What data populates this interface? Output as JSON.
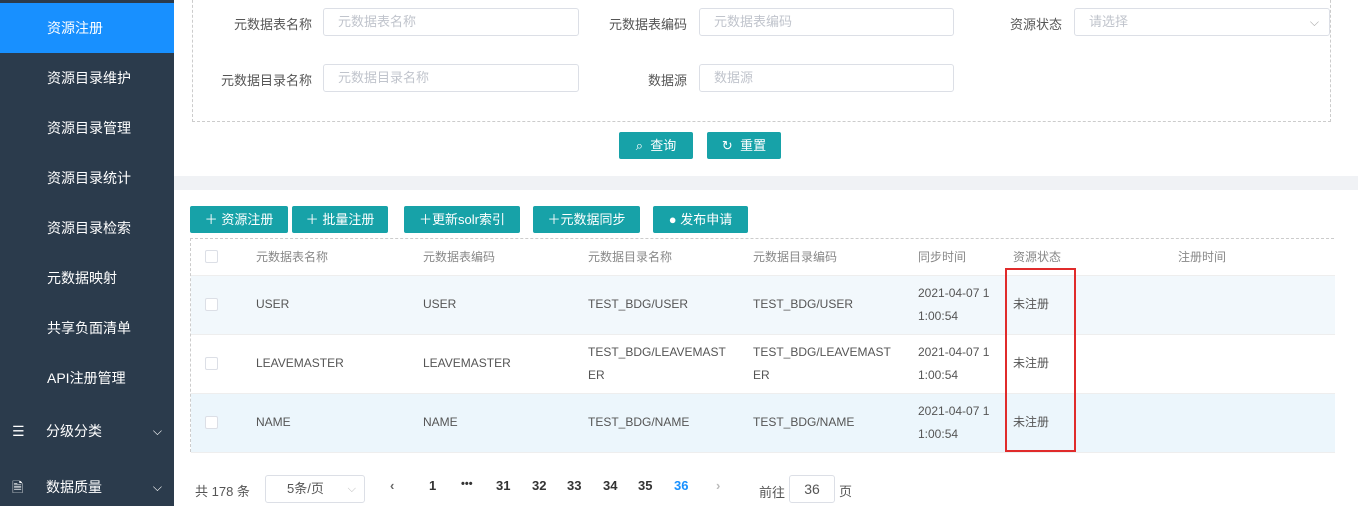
{
  "sidebar": {
    "items": [
      {
        "label": "资源注册"
      },
      {
        "label": "资源目录维护"
      },
      {
        "label": "资源目录管理"
      },
      {
        "label": "资源目录统计"
      },
      {
        "label": "资源目录检索"
      },
      {
        "label": "元数据映射"
      },
      {
        "label": "共享负面清单"
      },
      {
        "label": "API注册管理"
      },
      {
        "label": "分级分类"
      },
      {
        "label": "数据质量"
      }
    ]
  },
  "search": {
    "f1_label": "元数据表名称",
    "f1_ph": "元数据表名称",
    "f2_label": "元数据表编码",
    "f2_ph": "元数据表编码",
    "f3_label": "资源状态",
    "f3_ph": "请选择",
    "f4_label": "元数据目录名称",
    "f4_ph": "元数据目录名称",
    "f5_label": "数据源",
    "f5_ph": "数据源",
    "query": "查询",
    "reset": "重置"
  },
  "toolbar": {
    "register": "资源注册",
    "batch": "批量注册",
    "solr": "更新solr索引",
    "sync": "元数据同步",
    "publish": "发布申请"
  },
  "table": {
    "headers": [
      "元数据表名称",
      "元数据表编码",
      "元数据目录名称",
      "元数据目录编码",
      "同步时间",
      "资源状态",
      "注册时间"
    ],
    "rows": [
      {
        "name": "USER",
        "code": "USER",
        "dir1": "TEST_BDG/USER",
        "dir1b": "",
        "dir2": "TEST_BDG/USER",
        "dir2b": "",
        "t1": "2021-04-07 1",
        "t2": "1:00:54",
        "status": "未注册"
      },
      {
        "name": "LEAVEMASTER",
        "code": "LEAVEMASTER",
        "dir1": "TEST_BDG/LEAVEMAST",
        "dir1b": "ER",
        "dir2": "TEST_BDG/LEAVEMAST",
        "dir2b": "ER",
        "t1": "2021-04-07 1",
        "t2": "1:00:54",
        "status": "未注册"
      },
      {
        "name": "NAME",
        "code": "NAME",
        "dir1": "TEST_BDG/NAME",
        "dir1b": "",
        "dir2": "TEST_BDG/NAME",
        "dir2b": "",
        "t1": "2021-04-07 1",
        "t2": "1:00:54",
        "status": "未注册"
      }
    ]
  },
  "pager": {
    "total": "共 178 条",
    "size": "5条/页",
    "pages": [
      "1",
      "•••",
      "31",
      "32",
      "33",
      "34",
      "35",
      "36"
    ],
    "goto": "前往",
    "page_value": "36",
    "page_unit": "页"
  }
}
